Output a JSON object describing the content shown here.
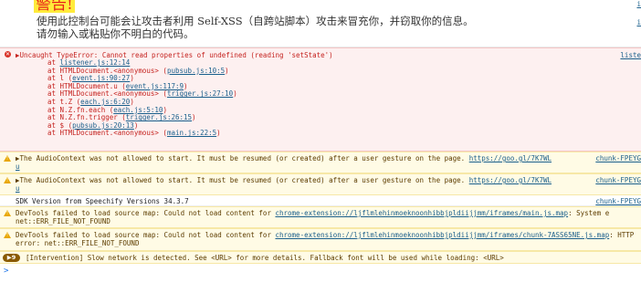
{
  "selfxss": {
    "title": "警告!",
    "line1": "使用此控制台可能会让攻击者利用 Self-XSS（自跨站脚本）攻击来冒充你，并窃取你的信息。",
    "line2": "请勿输入或粘贴你不明白的代码。",
    "src1": "i",
    "src2": "i"
  },
  "error": {
    "head": "▶Uncaught TypeError: Cannot read properties of undefined (reading 'setState')",
    "src": "liste",
    "frames": [
      {
        "at": "at ",
        "fn": "",
        "link": "listener.js:12:14"
      },
      {
        "at": "at HTMLDocument.<anonymous> (",
        "fn": "",
        "link": "pubsub.js:10:5",
        "tail": ")"
      },
      {
        "at": "at l (",
        "fn": "",
        "link": "event.js:90:27",
        "tail": ")"
      },
      {
        "at": "at HTMLDocument.u (",
        "fn": "",
        "link": "event.js:117:9",
        "tail": ")"
      },
      {
        "at": "at HTMLDocument.<anonymous> (",
        "fn": "",
        "link": "trigger.js:27:10",
        "tail": ")"
      },
      {
        "at": "at t.Z (",
        "fn": "",
        "link": "each.js:6:20",
        "tail": ")"
      },
      {
        "at": "at N.Z.fn.each (",
        "fn": "",
        "link": "each.js:5:10",
        "tail": ")"
      },
      {
        "at": "at N.Z.fn.trigger (",
        "fn": "",
        "link": "trigger.js:26:15",
        "tail": ")"
      },
      {
        "at": "at $ (",
        "fn": "",
        "link": "pubsub.js:20:13",
        "tail": ")"
      },
      {
        "at": "at HTMLDocument.<anonymous> (",
        "fn": "",
        "link": "main.js:22:5",
        "tail": ")"
      }
    ]
  },
  "warn1": {
    "text": "▶The AudioContext was not allowed to start. It must be resumed (or created) after a user gesture on the page. ",
    "link": "https://goo.gl/7K7WL",
    "wrap": "u",
    "src": "chunk-FPEYG"
  },
  "warn2": {
    "text": "▶The AudioContext was not allowed to start. It must be resumed (or created) after a user gesture on the page. ",
    "link": "https://goo.gl/7K7WL",
    "wrap": "u",
    "src": "chunk-FPEYG"
  },
  "sdk": {
    "text": "SDK Version from Speechify Versions 34.3.7",
    "src": "chunk-FPEYG"
  },
  "warn3": {
    "text": "DevTools failed to load source map: Could not load content for ",
    "link": "chrome-extension://ljflmlehinmoeknoonhibbjpldiijjmm/iframes/main.js.map",
    "tail": ": System e",
    "line2": "net::ERR_FILE_NOT_FOUND"
  },
  "warn4": {
    "text": "DevTools failed to load source map: Could not load content for ",
    "link": "chrome-extension://ljflmlehinmoeknoonhibbjpldiijjmm/iframes/chunk-7ASS65NE.js.map",
    "tail": ": HTTP",
    "line2": "error: net::ERR_FILE_NOT_FOUND"
  },
  "intervention": {
    "count": "▶9",
    "text": "[Intervention] Slow network is detected. See <URL> for more details. Fallback font will be used while loading: <URL>"
  },
  "prompt": ">"
}
